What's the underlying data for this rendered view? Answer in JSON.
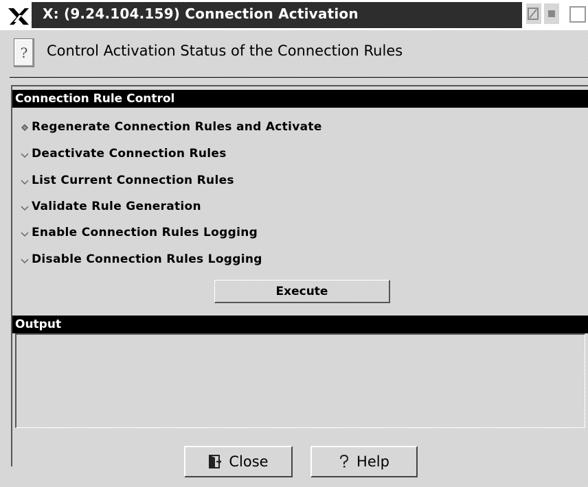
{
  "window": {
    "title": "X: (9.24.104.159) Connection Activation"
  },
  "header": {
    "help_icon": "?",
    "text": "Control Activation Status of the Connection Rules"
  },
  "control_section": {
    "title": "Connection Rule Control",
    "options": [
      {
        "label": "Regenerate Connection Rules and Activate",
        "selected": true
      },
      {
        "label": "Deactivate Connection Rules",
        "selected": false
      },
      {
        "label": "List Current Connection Rules",
        "selected": false
      },
      {
        "label": "Validate Rule Generation",
        "selected": false
      },
      {
        "label": "Enable Connection Rules Logging",
        "selected": false
      },
      {
        "label": "Disable Connection Rules Logging",
        "selected": false
      }
    ],
    "execute_label": "Execute"
  },
  "output_section": {
    "title": "Output",
    "content": ""
  },
  "footer": {
    "close_label": "Close",
    "close_icon": "close-door-icon",
    "help_label": "Help",
    "help_icon": "question-mark-icon"
  },
  "colors": {
    "title_bar": "#1c1c1c",
    "section_bar": "#000000",
    "background": "#d9d9d9"
  }
}
